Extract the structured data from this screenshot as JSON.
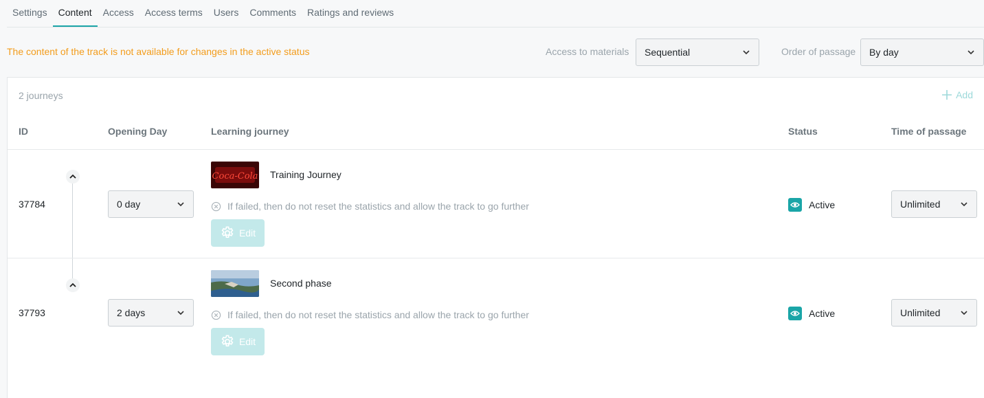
{
  "tabs": [
    {
      "label": "Settings"
    },
    {
      "label": "Content",
      "active": true
    },
    {
      "label": "Access"
    },
    {
      "label": "Access terms"
    },
    {
      "label": "Users"
    },
    {
      "label": "Comments"
    },
    {
      "label": "Ratings and reviews"
    }
  ],
  "warning": "The content of the track is not available for changes in the active status",
  "access_materials": {
    "label": "Access to materials",
    "value": "Sequential"
  },
  "order_passage": {
    "label": "Order of passage",
    "value": "By day"
  },
  "panel": {
    "count": "2 journeys",
    "add_label": "Add",
    "columns": {
      "id": "ID",
      "opening_day": "Opening Day",
      "journey": "Learning journey",
      "status": "Status",
      "time": "Time of passage"
    }
  },
  "rows": [
    {
      "id": "37784",
      "opening_day": "0 day",
      "name": "Training Journey",
      "note": "If failed, then do not reset the statistics and allow the track to go further",
      "edit_label": "Edit",
      "status": "Active",
      "time": "Unlimited",
      "thumb_text": "Coca-Cola"
    },
    {
      "id": "37793",
      "opening_day": "2 days",
      "name": "Second phase",
      "note": "If failed, then do not reset the statistics and allow the track to go further",
      "edit_label": "Edit",
      "status": "Active",
      "time": "Unlimited"
    }
  ],
  "colors": {
    "accent": "#1aa5a7",
    "warning": "#f39c1b",
    "edit_disabled": "#c3e9ea"
  },
  "icons": [
    "chevron-down-icon",
    "chevron-up-icon",
    "plus-icon",
    "close-circle-icon",
    "gear-icon",
    "eye-icon"
  ]
}
